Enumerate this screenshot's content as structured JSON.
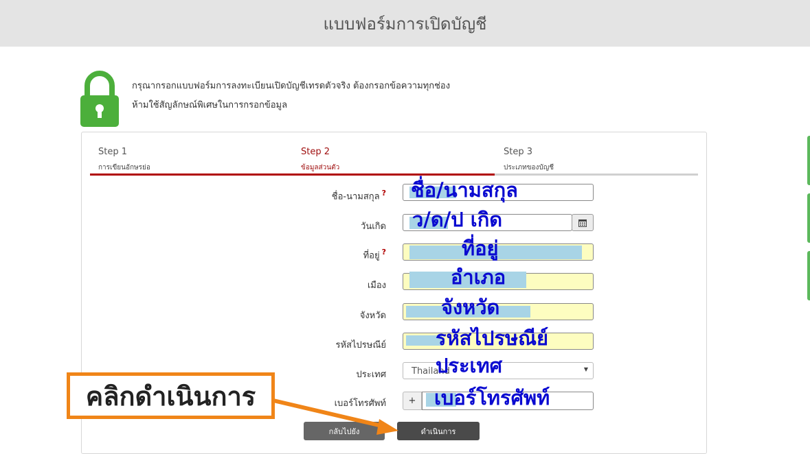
{
  "header": {
    "title": "แบบฟอร์มการเปิดบัญชี"
  },
  "intro": {
    "line1": "กรุณากรอกแบบฟอร์มการลงทะเบียนเปิดบัญชีเทรดตัวจริง ต้องกรอกข้อความทุกช่อง",
    "line2": "ห้ามใช้สัญลักษณ์พิเศษในการกรอกข้อมูล"
  },
  "steps": [
    {
      "label": "Step 1",
      "desc": "การเขียนอักษรย่อ"
    },
    {
      "label": "Step 2",
      "desc": "ข้อมูลส่วนตัว"
    },
    {
      "label": "Step 3",
      "desc": "ประเภทของบัญชี"
    }
  ],
  "active_step": 2,
  "form": {
    "name_label": "ชื่อ-นามสกุล",
    "required_mark": "?",
    "dob_label": "วันเกิด",
    "address_label": "ที่อยู่",
    "city_label": "เมือง",
    "province_label": "จังหวัด",
    "zip_label": "รหัสไปรษณีย์",
    "country_label": "ประเทศ",
    "country_value": "Thailand",
    "phone_label": "เบอร์โทรศัพท์",
    "phone_prefix": "+"
  },
  "annotations": {
    "name": "ชื่อ/นามสกุล",
    "dob": "ว/ด/ป เกิด",
    "address": "ที่อยู่",
    "city": "อำเภอ",
    "province": "จังหวัด",
    "zip": "รหัสไปรษณีย์",
    "country": "ประเทศ",
    "phone": "เบอร์โทรศัพท์",
    "callout": "คลิกดำเนินการ"
  },
  "buttons": {
    "back": "กลับไปยัง",
    "next": "ดำเนินการ"
  },
  "colors": {
    "accent_red": "#b00000",
    "callout_orange": "#f08518",
    "annotation_blue": "#0a0ad0",
    "lock_green": "#4caf3b",
    "highlight_field": "#fdfdc0"
  },
  "icons": [
    "lock-icon",
    "calendar-icon",
    "caret-down-icon",
    "arrow-icon"
  ]
}
